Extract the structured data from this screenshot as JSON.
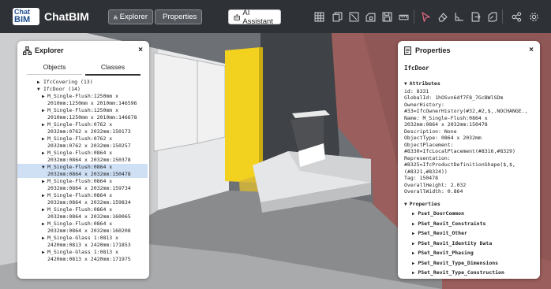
{
  "app": {
    "logo_top": "Chat",
    "logo_bottom": "BIM",
    "name": "ChatBIM"
  },
  "toolbar": {
    "explorer_label": "Explorer",
    "properties_label": "Properties",
    "ai_label": "AI Assistant",
    "tools": [
      "grid-icon",
      "copy-icon",
      "tag-icon",
      "camera-box-icon",
      "floppy-icon",
      "measure-icon",
      "cursor-icon",
      "eraser-icon",
      "angle-icon",
      "export-icon",
      "cut-icon",
      "share-icon",
      "settings-icon"
    ]
  },
  "explorer": {
    "title": "Explorer",
    "close": "×",
    "tabs": [
      "Objects",
      "Classes"
    ],
    "active_tab": "Classes",
    "roots": [
      {
        "label": "IfcCovering (13)",
        "expanded": false
      },
      {
        "label": "IfcDoor (14)",
        "expanded": true
      }
    ],
    "items": [
      "M_Single-Flush:1250mm x 2010mm:1250mm x 2010mm:146596",
      "M_Single-Flush:1250mm x 2010mm:1250mm x 2010mm:146678",
      "M_Single-Flush:0762 x 2032mm:0762 x 2032mm:150173",
      "M_Single-Flush:0762 x 2032mm:0762 x 2032mm:150257",
      "M_Single-Flush:0864 x 2032mm:0864 x 2032mm:150378",
      "M_Single-Flush:0864 x 2032mm:0864 x 2032mm:150478",
      "M_Single-Flush:0864 x 2032mm:0864 x 2032mm:159734",
      "M_Single-Flush:0864 x 2032mm:0864 x 2032mm:159834",
      "M_Single-Flush:0864 x 2032mm:0864 x 2032mm:160065",
      "M_Single-Flush:0864 x 2032mm:0864 x 2032mm:160208",
      "M_Single-Glass 1:0813 x 2420mm:0813 x 2420mm:171853",
      "M_Single-Glass 1:0813 x 2420mm:0813 x 2420mm:171975"
    ],
    "selected_item": "M_Single-Flush:0864 x 2032mm:0864 x 2032mm:150478"
  },
  "properties": {
    "title": "Properties",
    "close": "×",
    "entity": "IfcDoor",
    "attributes_header": "Attributes",
    "attributes": [
      "id: 8331",
      "GlobalId: 1hOSvn6df7F8_7GcBWlSDm",
      "OwnerHistory:",
      "#33=IfcOwnerHistory(#32,#2,$,.NOCHANGE.,",
      "Name: M_Single-Flush:0864 x",
      "2032mm:0864 x 2032mm:150478",
      "Description: None",
      "ObjectType: 0864 x 2032mm",
      "ObjectPlacement:",
      "#8330=IfcLocalPlacement(#8316,#8329)",
      "Representation:",
      "#8325=IfcProductDefinitionShape($,$,",
      "(#8321,#8324))",
      "Tag: 150478",
      "OverallHeight: 2.032",
      "OverallWidth: 0.864"
    ],
    "properties_header": "Properties",
    "psets": [
      "Pset_DoorCommon",
      "PSet_Revit_Constraints",
      "PSet_Revit_Other",
      "PSet_Revit_Identity Data",
      "PSet_Revit_Phasing",
      "PSet_Revit_Type_Dimensions",
      "PSet_Revit_Type_Construction"
    ]
  },
  "colors": {
    "topbar": "#2e3136",
    "accent_yellow": "#f2d21e",
    "wall_red": "#9b5d5b",
    "selection": "#cfe0f5"
  }
}
